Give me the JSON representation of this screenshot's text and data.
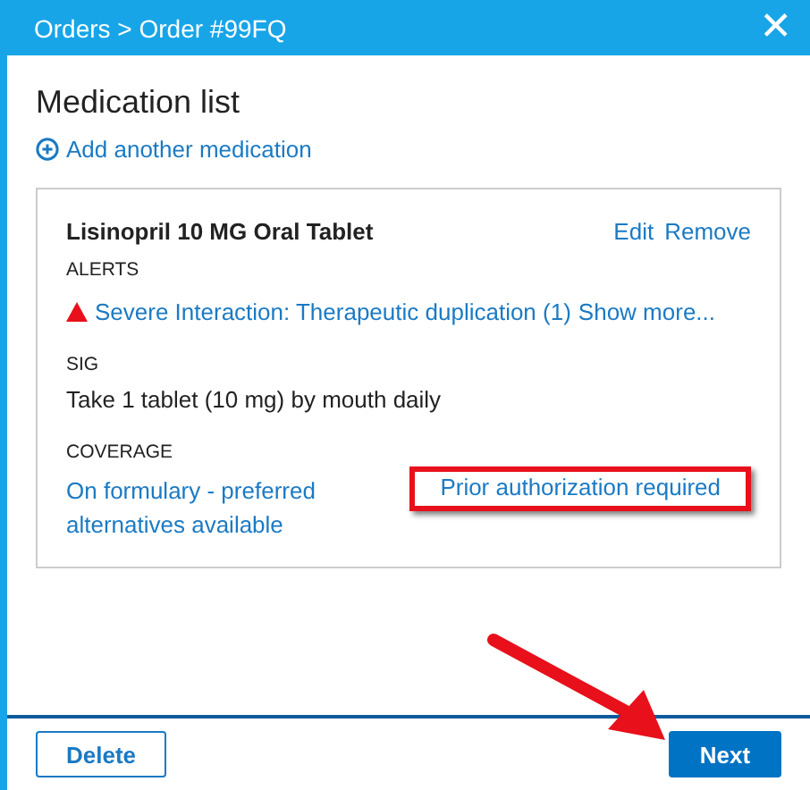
{
  "header": {
    "breadcrumb": "Orders > Order #99FQ",
    "close": "✕"
  },
  "title": "Medication list",
  "add_link": "Add another medication",
  "medications": [
    {
      "name": "Lisinopril 10 MG Oral Tablet",
      "actions": [
        "Edit",
        "Remove"
      ],
      "alerts_label": "ALERTS",
      "alerts": [
        {
          "text": "Severe Interaction: Therapeutic duplication (1)",
          "more": "Show more..."
        }
      ],
      "sig_label": "SIG",
      "sig": "Take 1 tablet (10 mg) by mouth daily",
      "coverage_label": "COVERAGE",
      "coverage": [
        {
          "text": "On formulary - preferred alternatives available",
          "highlighted": false
        },
        {
          "text": "Prior authorization required",
          "highlighted": true
        }
      ]
    }
  ],
  "footer": {
    "delete_button": "Delete",
    "next_button": "Next",
    "arrow_to_next": true
  }
}
